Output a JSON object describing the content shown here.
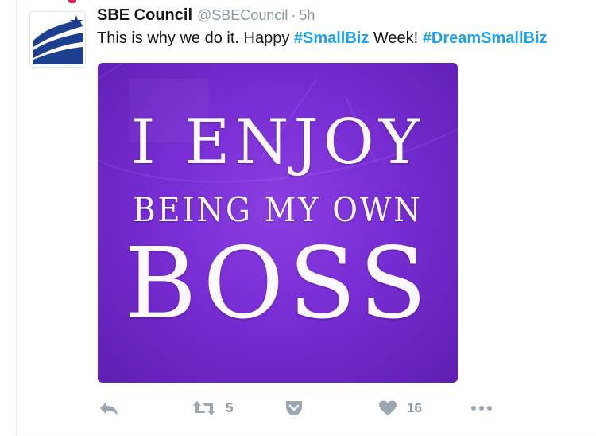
{
  "tweet": {
    "author_name": "SBE Council",
    "handle": "@SBECouncil",
    "separator": "·",
    "time": "5h",
    "text_prefix": "This is why we do it. Happy ",
    "hashtag_1": "#SmallBiz",
    "text_middle": " Week! ",
    "hashtag_2": "#DreamSmallBiz"
  },
  "media": {
    "line_1": "I ENJOY",
    "line_2": "BEING MY OWN",
    "line_3": "BOSS"
  },
  "actions": {
    "retweet_count": "5",
    "like_count": "16"
  },
  "colors": {
    "hashtag": "#1da1f2",
    "action_icon": "#9aa7b2",
    "media_background": "#7a2fd6"
  },
  "icons": {
    "reply": "reply-icon",
    "retweet": "retweet-icon",
    "save": "pocket-save-icon",
    "like": "heart-icon",
    "more": "more-icon"
  }
}
